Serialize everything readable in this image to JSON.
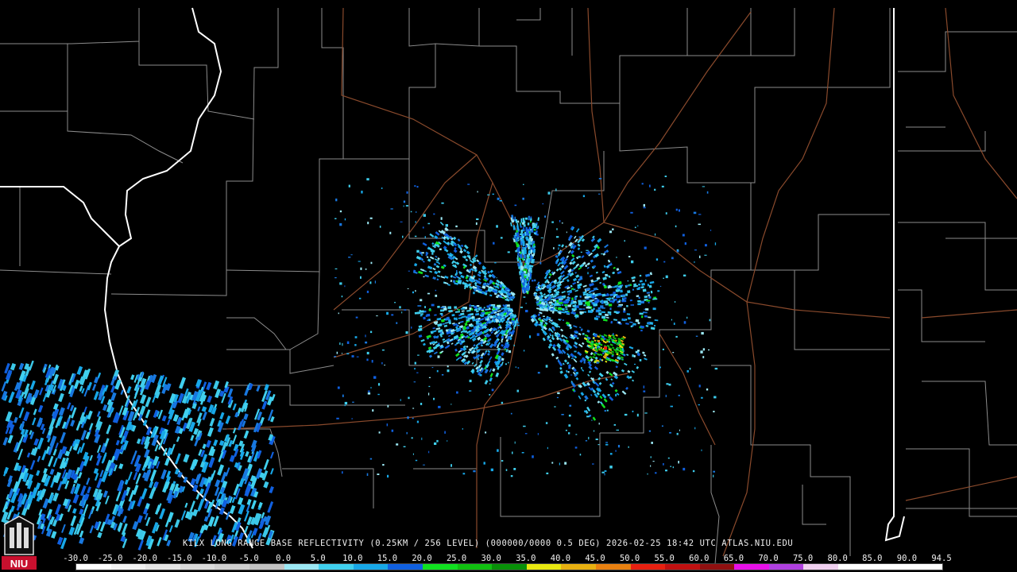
{
  "caption": "KILX LONG RANGE BASE REFLECTIVITY (0.25KM / 256 LEVEL) (000000/0000 0.5 DEG) 2026-02-25 18:42 UTC  ATLAS.NIU.EDU",
  "logo_text": "NIU",
  "colorbar": {
    "labels": [
      "-30.0",
      "-25.0",
      "-20.0",
      "-15.0",
      "-10.0",
      "-5.0",
      "0.0",
      "5.0",
      "10.0",
      "15.0",
      "20.0",
      "25.0",
      "30.0",
      "35.0",
      "40.0",
      "45.0",
      "50.0",
      "55.0",
      "60.0",
      "65.0",
      "70.0",
      "75.0",
      "80.0",
      "85.0",
      "90.0",
      "94.5"
    ],
    "colors": [
      "#ffffff",
      "#f2f2f2",
      "#e6e6e6",
      "#dadada",
      "#cfcfcf",
      "#c3c3c3",
      "#9ce8f4",
      "#40d0ee",
      "#18a8e8",
      "#1060e0",
      "#10e020",
      "#10c010",
      "#089008",
      "#e8e810",
      "#e8b010",
      "#e88010",
      "#e82010",
      "#c01010",
      "#901010",
      "#e810e8",
      "#b040e0",
      "#f0d0f0",
      "#ffffff",
      "#ffffff",
      "#ffffff"
    ]
  },
  "colors": {
    "background": "#000000",
    "county_lines": "#8c8c8c",
    "state_lines": "#ffffff",
    "highways": "#8a4a2c"
  }
}
